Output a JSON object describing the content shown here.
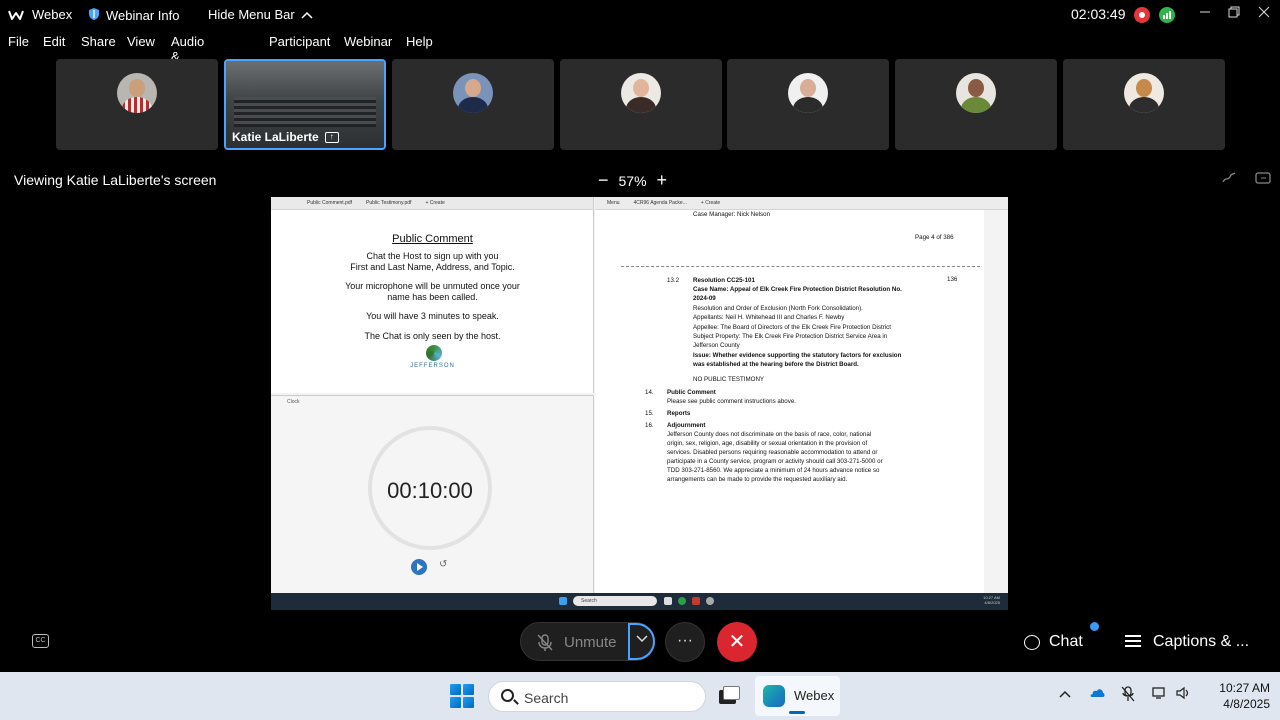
{
  "titlebar": {
    "app_name": "Webex",
    "webinar_info": "Webinar Info",
    "hide_menu": "Hide Menu Bar",
    "timer": "02:03:49"
  },
  "menu": [
    "File",
    "Edit",
    "Share",
    "View",
    "Audio & Video",
    "Participant",
    "Webinar",
    "Help"
  ],
  "participants": {
    "active_name": "Katie LaLiberte"
  },
  "viewing": {
    "label": "Viewing Katie LaLiberte's screen",
    "zoom_minus": "−",
    "zoom_level": "57%",
    "zoom_plus": "+"
  },
  "shared": {
    "left_tabs": [
      "Public Comment.pdf",
      "Public Testimony.pdf",
      "+ Create"
    ],
    "public_comment": {
      "title": "Public Comment",
      "line1": "Chat the Host to sign up with you",
      "line2": "First and Last Name, Address, and Topic.",
      "line3": "Your microphone will be unmuted once your",
      "line4": "name has been called.",
      "line5": "You will have 3 minutes to speak.",
      "line6": "The Chat is only seen by the host.",
      "logo_text": "JEFFERSON"
    },
    "clock": {
      "label": "Clock",
      "time": "00:10:00"
    },
    "right_tabs": [
      "Menu",
      "4CR96 Agenda Packe...",
      "+ Create"
    ],
    "doc": {
      "case_manager": "Case Manager: Nick Nelson",
      "page": "Page 4 of 386",
      "item_num": "13.2",
      "resolution": "Resolution CC25-101",
      "page_ref": "136",
      "case_name": "Case Name: Appeal of Elk Creek Fire Protection District Resolution No.",
      "case_year": "2024-09",
      "order": "Resolution and Order of Exclusion (North Fork Consolidation).",
      "appellants": "Appellants: Neil H. Whitehead III and Charles F. Newby",
      "appellee": "Appellee: The Board of Directors of the Elk Creek Fire Protection District",
      "subject": "Subject Property: The Elk Creek Fire Protection District Service Area in",
      "county": "Jefferson County",
      "issue1": "Issue: Whether evidence supporting the statutory factors for exclusion",
      "issue2": "was established at the hearing before the District Board.",
      "no_testimony": "NO PUBLIC TESTIMONY",
      "n14": "14.",
      "pc_heading": "Public Comment",
      "pc_text": "Please see public comment instructions above.",
      "n15": "15.",
      "reports": "Reports",
      "n16": "16.",
      "adjourn": "Adjournment",
      "p1": "Jefferson County does not discriminate on the basis of race, color, national",
      "p2": "origin, sex, religion, age, disability or sexual orientation in the provision of",
      "p3": "services.  Disabled persons requiring reasonable accommodation to attend or",
      "p4": "participate in a County service, program or activity should call 303-271-5000 or",
      "p5": "TDD 303-271-8560.  We appreciate a minimum of 24 hours advance notice so",
      "p6": "arrangements can be made to provide the requested auxiliary aid."
    },
    "mini_taskbar": {
      "search": "Search",
      "time": "10:27 AM",
      "date": "4/8/2025"
    }
  },
  "controls": {
    "unmute": "Unmute",
    "more": "···",
    "end": "✕",
    "chat": "Chat",
    "captions": "Captions & ..."
  },
  "taskbar": {
    "search": "Search",
    "webex": "Webex",
    "time": "10:27 AM",
    "date": "4/8/2025"
  }
}
